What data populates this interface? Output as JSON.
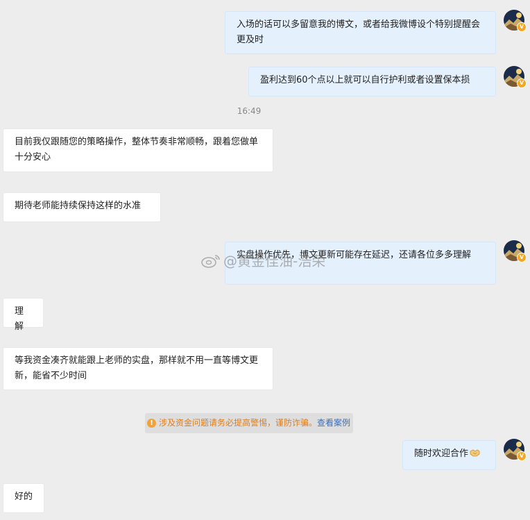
{
  "messages": [
    {
      "id": 1,
      "side": "out",
      "text": "入场的话可以多留意我的博文，或者给我微博设个特别提醒会更及时"
    },
    {
      "id": 2,
      "side": "out",
      "text": "盈利达到60个点以上就可以自行护利或者设置保本损"
    },
    {
      "id": 3,
      "side": "in",
      "text": "目前我仅跟随您的策略操作，整体节奏非常顺畅，跟着您做单十分安心"
    },
    {
      "id": 4,
      "side": "in",
      "text": "期待老师能持续保持这样的水准"
    },
    {
      "id": 5,
      "side": "out",
      "text": "实盘操作优先，博文更新可能存在延迟，还请各位多多理解"
    },
    {
      "id": 6,
      "side": "in",
      "text": "理解"
    },
    {
      "id": 7,
      "side": "in",
      "text": "等我资金凑齐就能跟上老师的实盘，那样就不用一直等博文更新，能省不少时间"
    },
    {
      "id": 8,
      "side": "out",
      "text": "随时欢迎合作"
    },
    {
      "id": 9,
      "side": "in",
      "text": "好的"
    }
  ],
  "timestamp": "16:49",
  "notice": {
    "text": "涉及资金问题请务必提高警惕，谨防诈骗。",
    "link": "查看案例",
    "icon": "warning-icon"
  },
  "watermark": "@黄金佳油-浩荣",
  "avatar_badge": "V",
  "emoji": "handshake-emoji",
  "colors": {
    "background": "#ededed",
    "out_bubble": "#e4f0fb",
    "in_bubble": "#ffffff",
    "notice_text": "#e07d1a",
    "notice_link": "#3c6fb6",
    "badge": "#f5a623"
  }
}
